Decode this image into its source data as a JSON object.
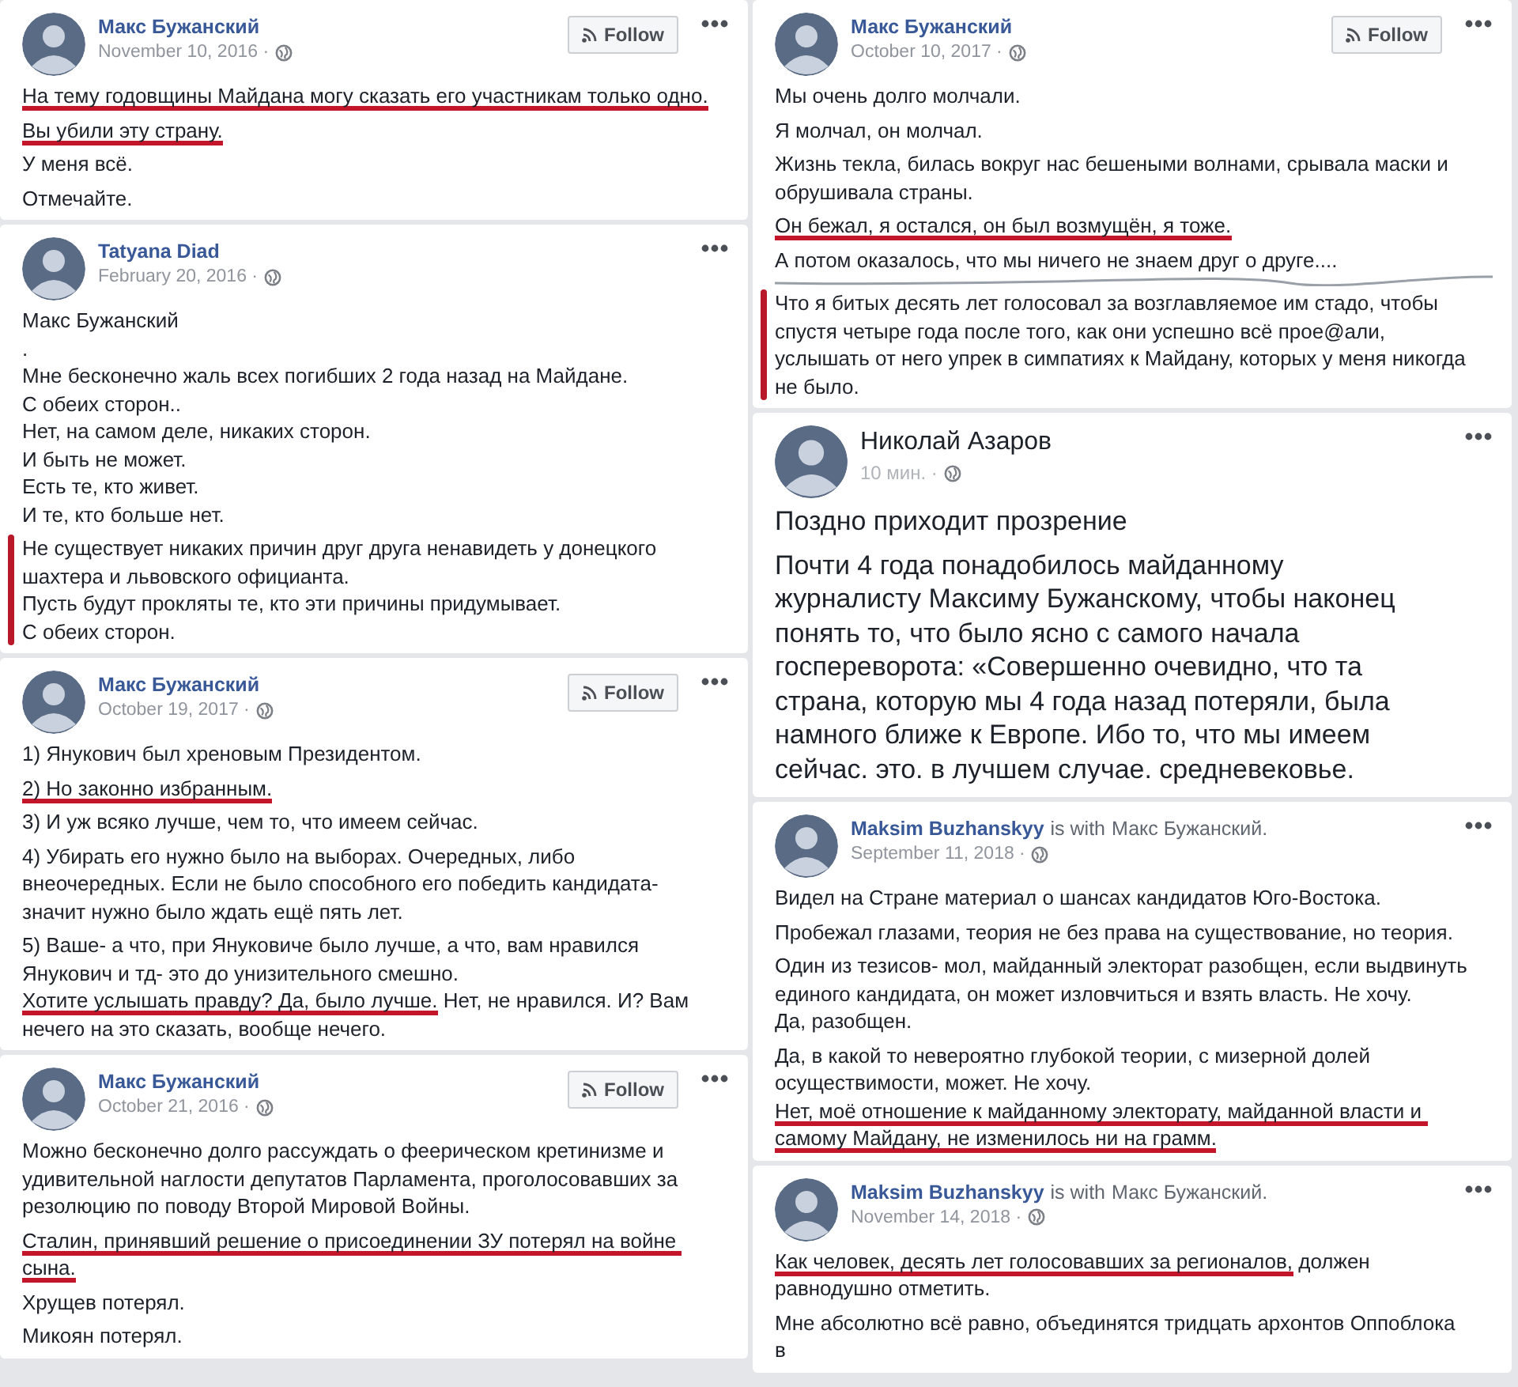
{
  "columns": [
    {
      "cards": [
        {
          "kind": "desktop",
          "author": "Макс Бужанский",
          "date": "November 10, 2016 ·",
          "follow": "Follow",
          "paragraphs": [
            {
              "bar": false,
              "lines": [
                [
                  {
                    "text": "На тему годовщины Майдана могу сказать его участникам только одно.",
                    "underline": true
                  }
                ]
              ]
            },
            {
              "bar": false,
              "lines": [
                [
                  {
                    "text": "Вы убили эту страну.",
                    "underline": true
                  }
                ]
              ]
            },
            {
              "bar": false,
              "lines": [
                [
                  {
                    "text": "У меня всё.",
                    "underline": false
                  }
                ]
              ]
            },
            {
              "bar": false,
              "lines": [
                [
                  {
                    "text": "Отмечайте.",
                    "underline": false
                  }
                ]
              ]
            }
          ]
        },
        {
          "kind": "desktop",
          "author": "Tatyana Diad",
          "date": "February 20, 2016 ·",
          "paragraphs": [
            {
              "bar": false,
              "lines": [
                [
                  {
                    "text": "Макс Бужанский",
                    "underline": false
                  }
                ],
                [
                  {
                    "text": ".",
                    "underline": false
                  }
                ],
                [
                  {
                    "text": "Мне бесконечно жаль всех погибших 2 года назад на Майдане.",
                    "underline": false
                  }
                ],
                [
                  {
                    "text": "С обеих сторон..",
                    "underline": false
                  }
                ],
                [
                  {
                    "text": "Нет, на самом деле, никаких сторон.",
                    "underline": false
                  }
                ],
                [
                  {
                    "text": "И быть не может.",
                    "underline": false
                  }
                ],
                [
                  {
                    "text": "Есть те, кто живет.",
                    "underline": false
                  }
                ],
                [
                  {
                    "text": "И те, кто больше нет.",
                    "underline": false
                  }
                ]
              ]
            },
            {
              "bar": true,
              "lines": [
                [
                  {
                    "text": "Не существует никаких причин друг друга ненавидеть у донецкого шахтера и львовского официанта.",
                    "underline": false
                  }
                ],
                [
                  {
                    "text": "Пусть будут прокляты те, кто эти причины придумывает.",
                    "underline": false
                  }
                ],
                [
                  {
                    "text": "С обеих сторон.",
                    "underline": false
                  }
                ]
              ]
            }
          ]
        },
        {
          "kind": "desktop",
          "author": "Макс Бужанский",
          "date": "October 19, 2017 ·",
          "follow": "Follow",
          "paragraphs": [
            {
              "bar": false,
              "lines": [
                [
                  {
                    "text": "1) Янукович был хреновым Президентом.",
                    "underline": false
                  }
                ]
              ]
            },
            {
              "bar": false,
              "lines": [
                [
                  {
                    "text": "2) Но законно избранным.",
                    "underline": true
                  }
                ]
              ]
            },
            {
              "bar": false,
              "lines": [
                [
                  {
                    "text": "3) И уж всяко лучше, чем то, что имеем сейчас.",
                    "underline": false
                  }
                ]
              ]
            },
            {
              "bar": false,
              "lines": [
                [
                  {
                    "text": "4) Убирать его нужно было на выборах. Очередных, либо внеочередных. Если не было способного его победить кандидата- значит нужно было ждать ещё пять лет.",
                    "underline": false
                  }
                ]
              ]
            },
            {
              "bar": false,
              "lines": [
                [
                  {
                    "text": "5) Ваше- а что, при Януковиче было лучше, а что, вам нравился Янукович и тд- это до унизительного смешно.",
                    "underline": false
                  }
                ],
                [
                  {
                    "text": "Хотите услышать правду? Да, было лучше.",
                    "underline": true
                  },
                  {
                    "text": " Нет, не нравился. И? Вам нечего на это сказать, вообще нечего.",
                    "underline": false
                  }
                ]
              ]
            }
          ]
        },
        {
          "kind": "desktop",
          "author": "Макс Бужанский",
          "date": "October 21, 2016 ·",
          "follow": "Follow",
          "paragraphs": [
            {
              "bar": false,
              "lines": [
                [
                  {
                    "text": "Можно бесконечно долго рассуждать о феерическом кретинизме и удивительной наглости депутатов Парламента, проголосовавших за резолюцию по поводу Второй Мировой Войны.",
                    "underline": false
                  }
                ]
              ]
            },
            {
              "bar": false,
              "lines": [
                [
                  {
                    "text": "Сталин, принявший решение о присоединении ЗУ потерял на войне сына.",
                    "underline": true
                  }
                ]
              ]
            },
            {
              "bar": false,
              "lines": [
                [
                  {
                    "text": "Хрущев потерял.",
                    "underline": false
                  }
                ]
              ]
            },
            {
              "bar": false,
              "lines": [
                [
                  {
                    "text": "Микоян потерял.",
                    "underline": false
                  }
                ]
              ]
            }
          ]
        }
      ]
    },
    {
      "cards": [
        {
          "kind": "desktop",
          "author": "Макс Бужанский",
          "date": "October 10, 2017 ·",
          "follow": "Follow",
          "paragraphs": [
            {
              "bar": false,
              "lines": [
                [
                  {
                    "text": "Мы очень долго молчали.",
                    "underline": false
                  }
                ]
              ]
            },
            {
              "bar": false,
              "lines": [
                [
                  {
                    "text": "Я молчал, он молчал.",
                    "underline": false
                  }
                ]
              ]
            },
            {
              "bar": false,
              "lines": [
                [
                  {
                    "text": "Жизнь текла, билась вокруг нас бешеными волнами, срывала маски и обрушивала страны.",
                    "underline": false
                  }
                ]
              ]
            },
            {
              "bar": false,
              "lines": [
                [
                  {
                    "text": "Он бежал, я остался, он был возмущён, я тоже.",
                    "underline": true
                  }
                ]
              ]
            },
            {
              "bar": false,
              "lines": [
                [
                  {
                    "text": "А потом оказалось, что мы ничего не знаем друг о друге....",
                    "underline": false
                  }
                ]
              ]
            },
            {
              "bar": true,
              "torn_edge": true,
              "lines": [
                [
                  {
                    "text": "Что я битых десять лет голосовал за возглавляемое им стадо, чтобы спустя четыре года после того, как они успешно всё прое@али, услышать от него упрек в симпатиях к Майдану, которых у меня никогда не было.",
                    "underline": false
                  }
                ]
              ]
            }
          ]
        },
        {
          "kind": "mobile",
          "author": "Николай Азаров",
          "date": "10 мин. ·",
          "paragraphs": [
            {
              "bar": false,
              "lines": [
                [
                  {
                    "text": "Поздно приходит прозрение",
                    "underline": false
                  }
                ]
              ]
            },
            {
              "bar": false,
              "lines": [
                [
                  {
                    "text": "Почти 4 года понадобилось майданному",
                    "underline": false
                  }
                ],
                [
                  {
                    "text": "журналисту Максиму Бужанскому, чтобы наконец",
                    "underline": false
                  }
                ],
                [
                  {
                    "text": "понять то, что было ясно с самого начала",
                    "underline": false
                  }
                ],
                [
                  {
                    "text": "госпереворота: «Совершенно очевидно, что та",
                    "underline": false
                  }
                ],
                [
                  {
                    "text": "страна, которую мы 4 года назад потеряли, была",
                    "underline": false
                  }
                ],
                [
                  {
                    "text": "намного ближе к Европе. Ибо то, что мы имеем",
                    "underline": false
                  }
                ],
                [
                  {
                    "text": "сейчас. это. в лучшем случае. средневековье.",
                    "underline": false
                  }
                ]
              ]
            }
          ]
        },
        {
          "kind": "desktop",
          "author": "Maksim Buzhanskyy",
          "with_label": "is with",
          "with_name": "Макс Бужанский.",
          "date": "September 11, 2018 ·",
          "paragraphs": [
            {
              "bar": false,
              "lines": [
                [
                  {
                    "text": "Видел на Стране материал о шансах кандидатов Юго-Востока.",
                    "underline": false
                  }
                ]
              ]
            },
            {
              "bar": false,
              "lines": [
                [
                  {
                    "text": "Пробежал глазами, теория не без права на существование, но теория.",
                    "underline": false
                  }
                ]
              ]
            },
            {
              "bar": false,
              "lines": [
                [
                  {
                    "text": "Один из тезисов- мол, майданный электорат разобщен, если выдвинуть единого кандидата, он может изловчиться и взять власть. Не хочу.",
                    "underline": false
                  }
                ],
                [
                  {
                    "text": "Да, разобщен.",
                    "underline": false
                  }
                ]
              ]
            },
            {
              "bar": false,
              "lines": [
                [
                  {
                    "text": "Да, в какой то невероятно глубокой теории, с мизерной долей осуществимости, может. Не хочу.",
                    "underline": false
                  }
                ],
                [
                  {
                    "text": "Нет, моё отношение к майданному электорату, майданной власти и самому Майдану, не изменилось ни на грамм.",
                    "underline": true
                  }
                ]
              ]
            }
          ]
        },
        {
          "kind": "desktop",
          "author": "Maksim Buzhanskyy",
          "with_label": "is with",
          "with_name": "Макс Бужанский.",
          "date": "November 14, 2018 ·",
          "paragraphs": [
            {
              "bar": false,
              "lines": [
                [
                  {
                    "text": "Как человек, десять лет голосовавших за регионалов,",
                    "underline": true
                  },
                  {
                    "text": " должен равнодушно отметить.",
                    "underline": false
                  }
                ]
              ]
            },
            {
              "bar": false,
              "lines": [
                [
                  {
                    "text": "Мне абсолютно всё равно, объединятся тридцать архонтов Оппоблока в",
                    "underline": false
                  }
                ]
              ]
            }
          ]
        }
      ]
    }
  ]
}
